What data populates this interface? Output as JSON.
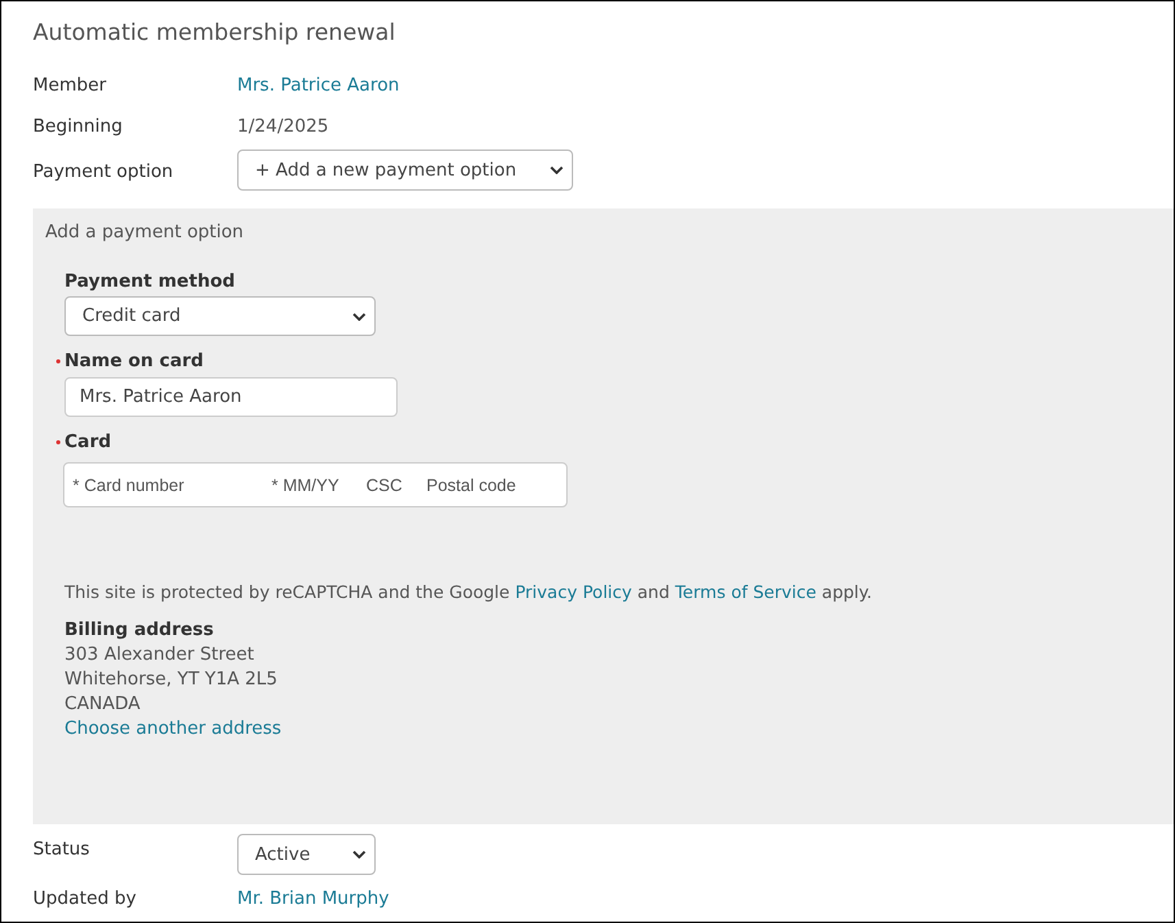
{
  "title": "Automatic membership renewal",
  "member": {
    "label": "Member",
    "value": "Mrs. Patrice Aaron"
  },
  "beginning": {
    "label": "Beginning",
    "value": "1/24/2025"
  },
  "payment_option": {
    "label": "Payment option",
    "value": "+ Add a new payment option"
  },
  "panel": {
    "heading": "Add a payment option",
    "payment_method": {
      "label": "Payment method",
      "value": "Credit card"
    },
    "name_on_card": {
      "label": "Name on card",
      "required": true,
      "value": "Mrs. Patrice Aaron"
    },
    "card": {
      "label": "Card",
      "required": true,
      "placeholders": [
        "* Card number",
        "* MM/YY",
        "CSC",
        "Postal code"
      ]
    },
    "notice": [
      {
        "kind": "text",
        "text": "This site is protected by reCAPTCHA and the Google"
      },
      {
        "kind": "link",
        "text": "Privacy Policy"
      },
      {
        "kind": "text",
        "text": "and"
      },
      {
        "kind": "link",
        "text": "Terms of Service"
      },
      {
        "kind": "text",
        "text": "apply."
      }
    ],
    "billing": {
      "label": "Billing address",
      "lines": [
        "303 Alexander Street",
        "Whitehorse, YT Y1A 2L5",
        "CANADA"
      ],
      "link": "Choose another address"
    }
  },
  "status": {
    "label": "Status",
    "value": "Active"
  },
  "updated_by": {
    "label": "Updated by",
    "value": "Mr. Brian Murphy"
  }
}
